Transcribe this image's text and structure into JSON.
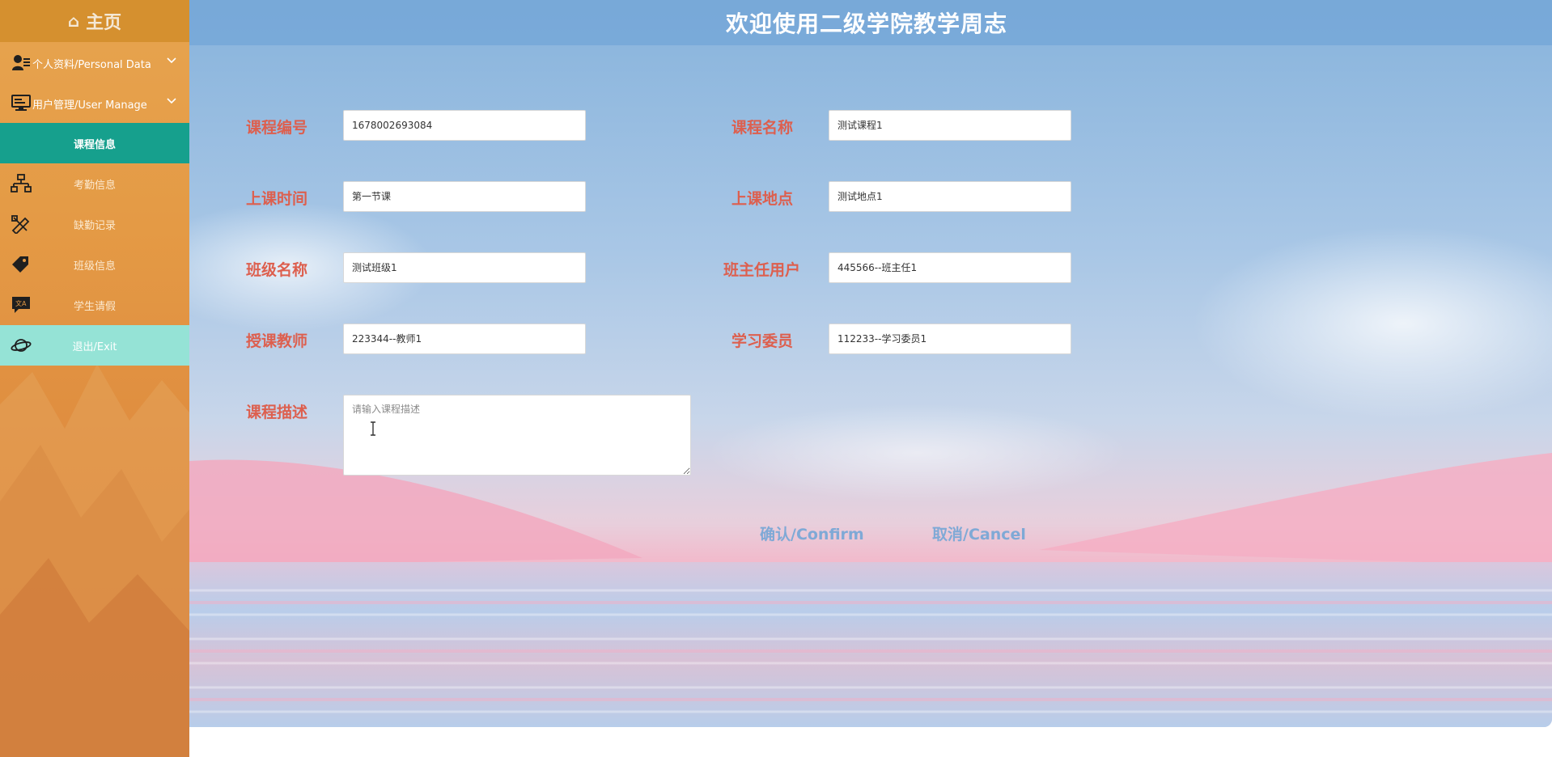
{
  "sidebar": {
    "home_label": "主页",
    "groups": [
      {
        "label": "个人资料/Personal Data",
        "icon": "user-card-icon"
      },
      {
        "label": "用户管理/User Manage",
        "icon": "monitor-icon"
      }
    ],
    "items": [
      {
        "label": "课程信息",
        "state": "active"
      },
      {
        "label": "考勤信息",
        "icon": "org-chart-icon"
      },
      {
        "label": "缺勤记录",
        "icon": "pencil-ruler-icon"
      },
      {
        "label": "班级信息",
        "icon": "tags-icon"
      },
      {
        "label": "学生请假",
        "icon": "translate-chat-icon"
      },
      {
        "label": "退出/Exit",
        "icon": "planet-icon"
      }
    ]
  },
  "header": {
    "title": "欢迎使用二级学院教学周志"
  },
  "form": {
    "course_no": {
      "label": "课程编号",
      "value": "1678002693084"
    },
    "course_name": {
      "label": "课程名称",
      "value": "测试课程1"
    },
    "class_time": {
      "label": "上课时间",
      "value": "第一节课"
    },
    "class_place": {
      "label": "上课地点",
      "value": "测试地点1"
    },
    "class_name": {
      "label": "班级名称",
      "value": "测试班级1"
    },
    "head_teacher": {
      "label": "班主任用户",
      "value": "445566--班主任1"
    },
    "teacher": {
      "label": "授课教师",
      "value": "223344--教师1"
    },
    "study_rep": {
      "label": "学习委员",
      "value": "112233--学习委员1"
    },
    "description": {
      "label": "课程描述",
      "value": "",
      "placeholder": "请输入课程描述"
    }
  },
  "actions": {
    "confirm_label": "确认/Confirm",
    "cancel_label": "取消/Cancel"
  },
  "colors": {
    "sidebar_top": "#d5902f",
    "sidebar_bg": "#e49a45",
    "active_item": "#16a08d",
    "exit_item": "#95e3d6",
    "label_red": "#dd5f4e",
    "button_blue": "#7fa9d6",
    "header_blue": "#73a5d7"
  }
}
